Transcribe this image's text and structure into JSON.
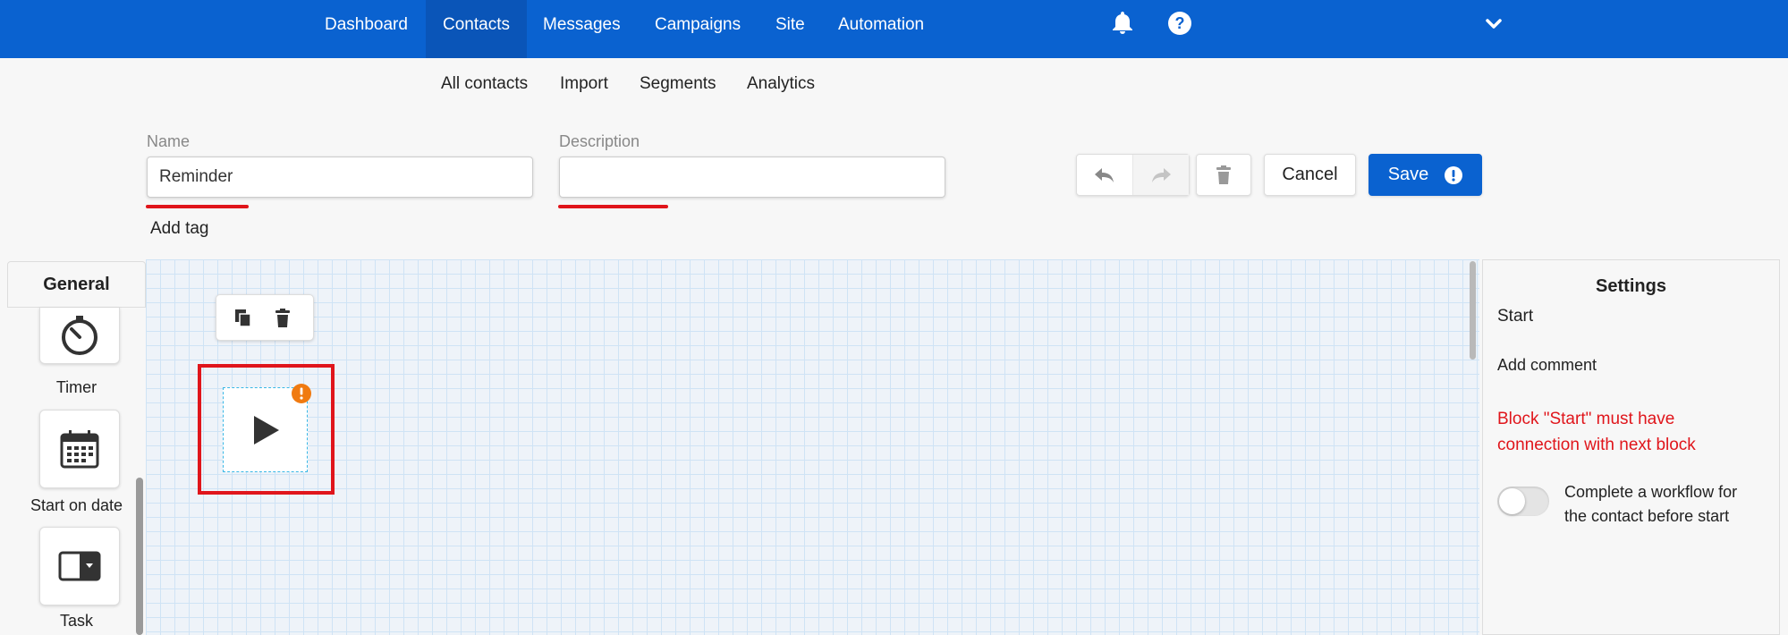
{
  "nav": {
    "items": [
      "Dashboard",
      "Contacts",
      "Messages",
      "Campaigns",
      "Site",
      "Automation"
    ],
    "active": "Contacts",
    "icons": [
      "bell-icon",
      "help-icon",
      "chevron-down-icon"
    ]
  },
  "subnav": {
    "items": [
      "All contacts",
      "Import",
      "Segments",
      "Analytics"
    ]
  },
  "form": {
    "name_label": "Name",
    "name_value": "Reminder",
    "description_label": "Description",
    "description_value": "",
    "add_tag": "Add tag"
  },
  "toolbar": {
    "cancel_label": "Cancel",
    "save_label": "Save"
  },
  "sidebar": {
    "tab_label": "General",
    "blocks": [
      {
        "label": "Timer",
        "icon": "timer-icon"
      },
      {
        "label": "Start on date",
        "icon": "calendar-icon"
      },
      {
        "label": "Task",
        "icon": "task-icon"
      }
    ]
  },
  "settings": {
    "title": "Settings",
    "block_name": "Start",
    "add_comment": "Add comment",
    "error": "Block \"Start\" must have connection with next block",
    "toggle_label": "Complete a workflow for the contact before start",
    "toggle_on": false
  },
  "colors": {
    "brand": "#0a62d0",
    "error": "#e0151b",
    "warning": "#f07a10"
  }
}
